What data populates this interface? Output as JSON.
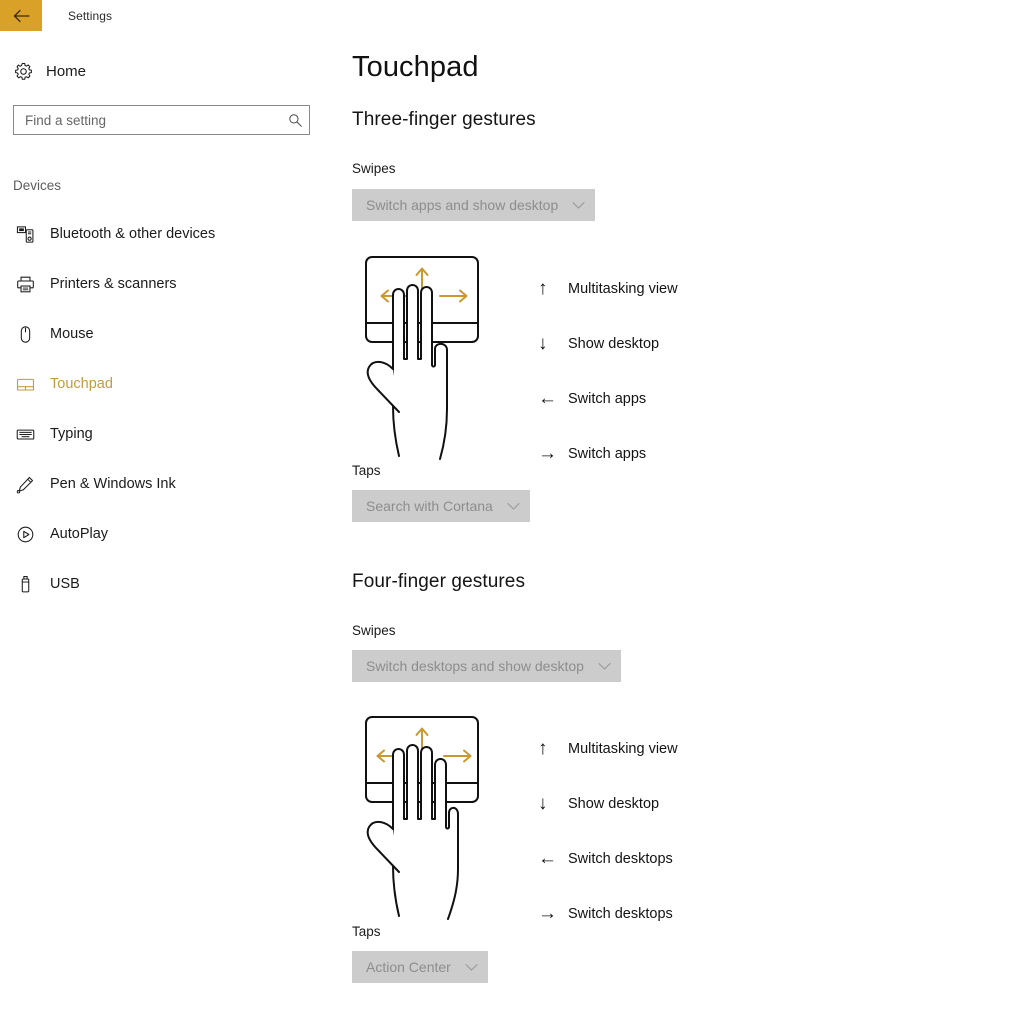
{
  "titlebar": {
    "back_icon": "back-arrow-icon",
    "title": "Settings",
    "accent_color": "#d9a128"
  },
  "sidebar": {
    "home": {
      "label": "Home",
      "icon": "gear-icon"
    },
    "search": {
      "value": "",
      "placeholder": "Find a setting",
      "icon": "search-icon"
    },
    "section_label": "Devices",
    "items": [
      {
        "label": "Bluetooth & other devices",
        "icon": "bluetooth-devices-icon",
        "selected": false
      },
      {
        "label": "Printers & scanners",
        "icon": "printer-icon",
        "selected": false
      },
      {
        "label": "Mouse",
        "icon": "mouse-icon",
        "selected": false
      },
      {
        "label": "Touchpad",
        "icon": "touchpad-icon",
        "selected": true
      },
      {
        "label": "Typing",
        "icon": "keyboard-icon",
        "selected": false
      },
      {
        "label": "Pen & Windows Ink",
        "icon": "pen-icon",
        "selected": false
      },
      {
        "label": "AutoPlay",
        "icon": "autoplay-icon",
        "selected": false
      },
      {
        "label": "USB",
        "icon": "usb-icon",
        "selected": false
      }
    ],
    "selected_color": "#c49a3f"
  },
  "main": {
    "page_title": "Touchpad",
    "sections": [
      {
        "heading": "Three-finger gestures",
        "swipes_label": "Swipes",
        "swipes_value": "Switch apps and show desktop",
        "taps_label": "Taps",
        "taps_value": "Search with Cortana",
        "fingers": 3,
        "legend": [
          {
            "arrow": "↑",
            "direction": "up",
            "action": "Multitasking view"
          },
          {
            "arrow": "↓",
            "direction": "down",
            "action": "Show desktop"
          },
          {
            "arrow": "←",
            "direction": "left",
            "action": "Switch apps"
          },
          {
            "arrow": "→",
            "direction": "right",
            "action": "Switch apps"
          }
        ]
      },
      {
        "heading": "Four-finger gestures",
        "swipes_label": "Swipes",
        "swipes_value": "Switch desktops and show desktop",
        "taps_label": "Taps",
        "taps_value": "Action Center",
        "fingers": 4,
        "legend": [
          {
            "arrow": "↑",
            "direction": "up",
            "action": "Multitasking view"
          },
          {
            "arrow": "↓",
            "direction": "down",
            "action": "Show desktop"
          },
          {
            "arrow": "←",
            "direction": "left",
            "action": "Switch desktops"
          },
          {
            "arrow": "→",
            "direction": "right",
            "action": "Switch desktops"
          }
        ]
      }
    ],
    "combo_chevron_icon": "chevron-down-icon",
    "figure_arrow_color": "#c9992e"
  }
}
